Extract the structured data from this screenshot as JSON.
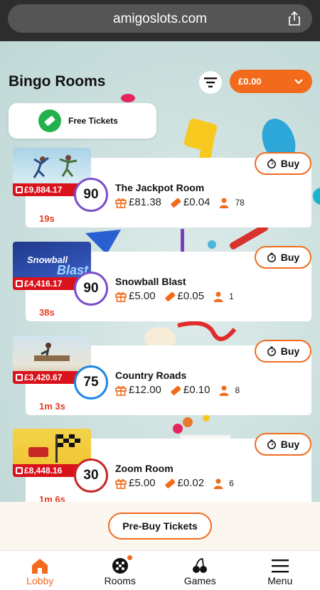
{
  "browser": {
    "url": "amigoslots.com"
  },
  "header": {
    "title": "Bingo Rooms",
    "balance": "£0.00"
  },
  "free_tickets": {
    "label": "Free Tickets"
  },
  "rooms": [
    {
      "name": "The Jackpot Room",
      "jackpot": "£9,884.17",
      "timer": "19s",
      "ball": "90",
      "prize": "£81.38",
      "ticket_price": "£0.04",
      "players": "78",
      "ball_color": "#7b4fc9",
      "buy_label": "Buy"
    },
    {
      "name": "Snowball Blast",
      "jackpot": "£4,416.17",
      "timer": "38s",
      "ball": "90",
      "prize": "£5.00",
      "ticket_price": "£0.05",
      "players": "1",
      "ball_color": "#7b4fc9",
      "buy_label": "Buy"
    },
    {
      "name": "Country Roads",
      "jackpot": "£3,420.67",
      "timer": "1m 3s",
      "ball": "75",
      "prize": "£12.00",
      "ticket_price": "£0.10",
      "players": "8",
      "ball_color": "#1e88e5",
      "buy_label": "Buy"
    },
    {
      "name": "Zoom Room",
      "jackpot": "£8,448.16",
      "timer": "1m 6s",
      "ball": "30",
      "prize": "£5.00",
      "ticket_price": "£0.02",
      "players": "6",
      "ball_color": "#c62828",
      "buy_label": "Buy"
    }
  ],
  "thumb_text": {
    "snowball": "Snowball",
    "blast": "Blast"
  },
  "prebuy": {
    "label": "Pre-Buy Tickets"
  },
  "nav": [
    {
      "label": "Lobby",
      "icon": "house-icon",
      "active": true
    },
    {
      "label": "Rooms",
      "icon": "bingo-ball-icon",
      "active": false
    },
    {
      "label": "Games",
      "icon": "cherries-icon",
      "active": false
    },
    {
      "label": "Menu",
      "icon": "hamburger-icon",
      "active": false
    }
  ],
  "colors": {
    "accent": "#f26b1d",
    "jackpot_bar": "#d9121b",
    "timer": "#e63c1e",
    "free_ticket_green": "#22b14c"
  }
}
